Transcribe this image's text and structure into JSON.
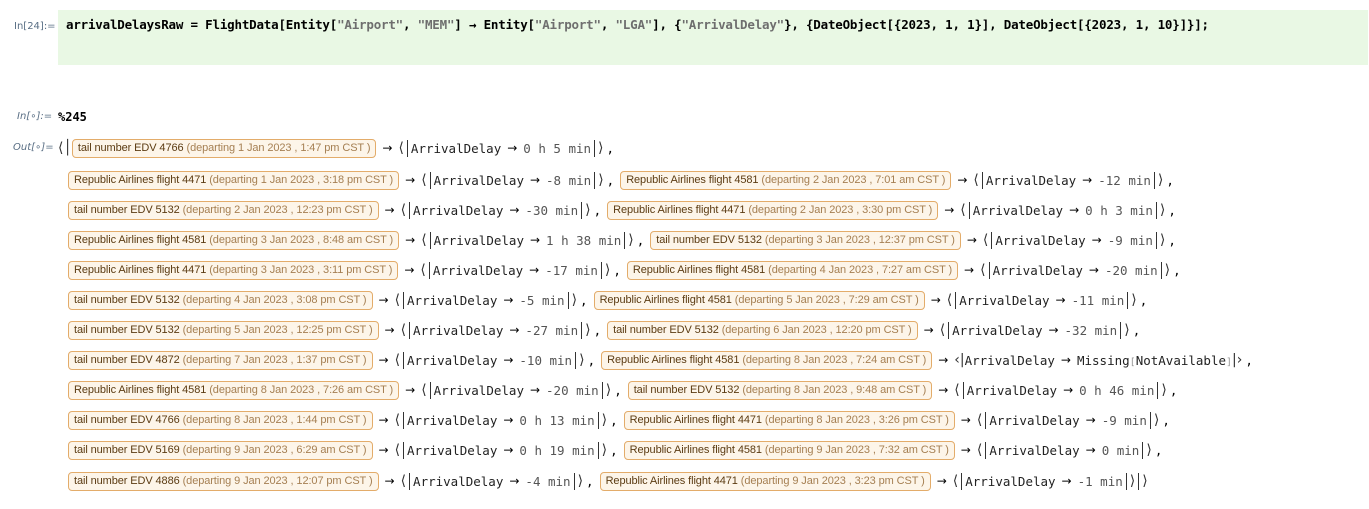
{
  "input_cell": {
    "label": "In[24]:=",
    "code_parts": [
      {
        "t": "arrivalDelaysRaw = FlightData[Entity[",
        "s": false
      },
      {
        "t": "\"Airport\"",
        "s": true
      },
      {
        "t": ", ",
        "s": false
      },
      {
        "t": "\"MEM\"",
        "s": true
      },
      {
        "t": "] → Entity[",
        "s": false
      },
      {
        "t": "\"Airport\"",
        "s": true
      },
      {
        "t": ", ",
        "s": false
      },
      {
        "t": "\"LGA\"",
        "s": true
      },
      {
        "t": "], {",
        "s": false
      },
      {
        "t": "\"ArrivalDelay\"",
        "s": true
      },
      {
        "t": "}, {DateObject[{2023, 1, 1}], DateObject[{2023, 1, 10}]}];",
        "s": false
      }
    ]
  },
  "input2": {
    "label": "In[∘]:=",
    "code": "%245"
  },
  "output": {
    "label": "Out[∘]=",
    "key": "ArrivalDelay",
    "departing_word": "departing",
    "timezone": "CST",
    "lines": [
      [
        {
          "flight": "tail number EDV 4766",
          "date": "1 Jan 2023 , 1:47 pm",
          "delay": "0 h 5 min"
        }
      ],
      [
        {
          "flight": "Republic Airlines flight 4471",
          "date": "1 Jan 2023 , 3:18 pm",
          "delay": "-8 min"
        },
        {
          "flight": "Republic Airlines flight 4581",
          "date": "2 Jan 2023 , 7:01 am",
          "delay": "-12 min"
        }
      ],
      [
        {
          "flight": "tail number EDV 5132",
          "date": "2 Jan 2023 , 12:23 pm",
          "delay": "-30 min"
        },
        {
          "flight": "Republic Airlines flight 4471",
          "date": "2 Jan 2023 , 3:30 pm",
          "delay": "0 h 3 min"
        }
      ],
      [
        {
          "flight": "Republic Airlines flight 4581",
          "date": "3 Jan 2023 , 8:48 am",
          "delay": "1 h 38 min"
        },
        {
          "flight": "tail number EDV 5132",
          "date": "3 Jan 2023 , 12:37 pm",
          "delay": "-9 min"
        }
      ],
      [
        {
          "flight": "Republic Airlines flight 4471",
          "date": "3 Jan 2023 , 3:11 pm",
          "delay": "-17 min"
        },
        {
          "flight": "Republic Airlines flight 4581",
          "date": "4 Jan 2023 , 7:27 am",
          "delay": "-20 min"
        }
      ],
      [
        {
          "flight": "tail number EDV 5132",
          "date": "4 Jan 2023 , 3:08 pm",
          "delay": "-5 min"
        },
        {
          "flight": "Republic Airlines flight 4581",
          "date": "5 Jan 2023 , 7:29 am",
          "delay": "-11 min"
        }
      ],
      [
        {
          "flight": "tail number EDV 5132",
          "date": "5 Jan 2023 , 12:25 pm",
          "delay": "-27 min"
        },
        {
          "flight": "tail number EDV 5132",
          "date": "6 Jan 2023 , 12:20 pm",
          "delay": "-32 min"
        }
      ],
      [
        {
          "flight": "tail number EDV 4872",
          "date": "7 Jan 2023 , 1:37 pm",
          "delay": "-10 min"
        },
        {
          "flight": "Republic Airlines flight 4581",
          "date": "8 Jan 2023 , 7:24 am",
          "delay": "Missing",
          "missing_reason": "NotAvailable"
        }
      ],
      [
        {
          "flight": "Republic Airlines flight 4581",
          "date": "8 Jan 2023 , 7:26 am",
          "delay": "-20 min"
        },
        {
          "flight": "tail number EDV 5132",
          "date": "8 Jan 2023 , 9:48 am",
          "delay": "0 h 46 min"
        }
      ],
      [
        {
          "flight": "tail number EDV 4766",
          "date": "8 Jan 2023 , 1:44 pm",
          "delay": "0 h 13 min"
        },
        {
          "flight": "Republic Airlines flight 4471",
          "date": "8 Jan 2023 , 3:26 pm",
          "delay": "-9 min"
        }
      ],
      [
        {
          "flight": "tail number EDV 5169",
          "date": "9 Jan 2023 , 6:29 am",
          "delay": "0 h 19 min"
        },
        {
          "flight": "Republic Airlines flight 4581",
          "date": "9 Jan 2023 , 7:32 am",
          "delay": "0 min"
        }
      ],
      [
        {
          "flight": "tail number EDV 4886",
          "date": "9 Jan 2023 , 12:07 pm",
          "delay": "-4 min"
        },
        {
          "flight": "Republic Airlines flight 4471",
          "date": "9 Jan 2023 , 3:23 pm",
          "delay": "-1 min"
        }
      ]
    ]
  }
}
